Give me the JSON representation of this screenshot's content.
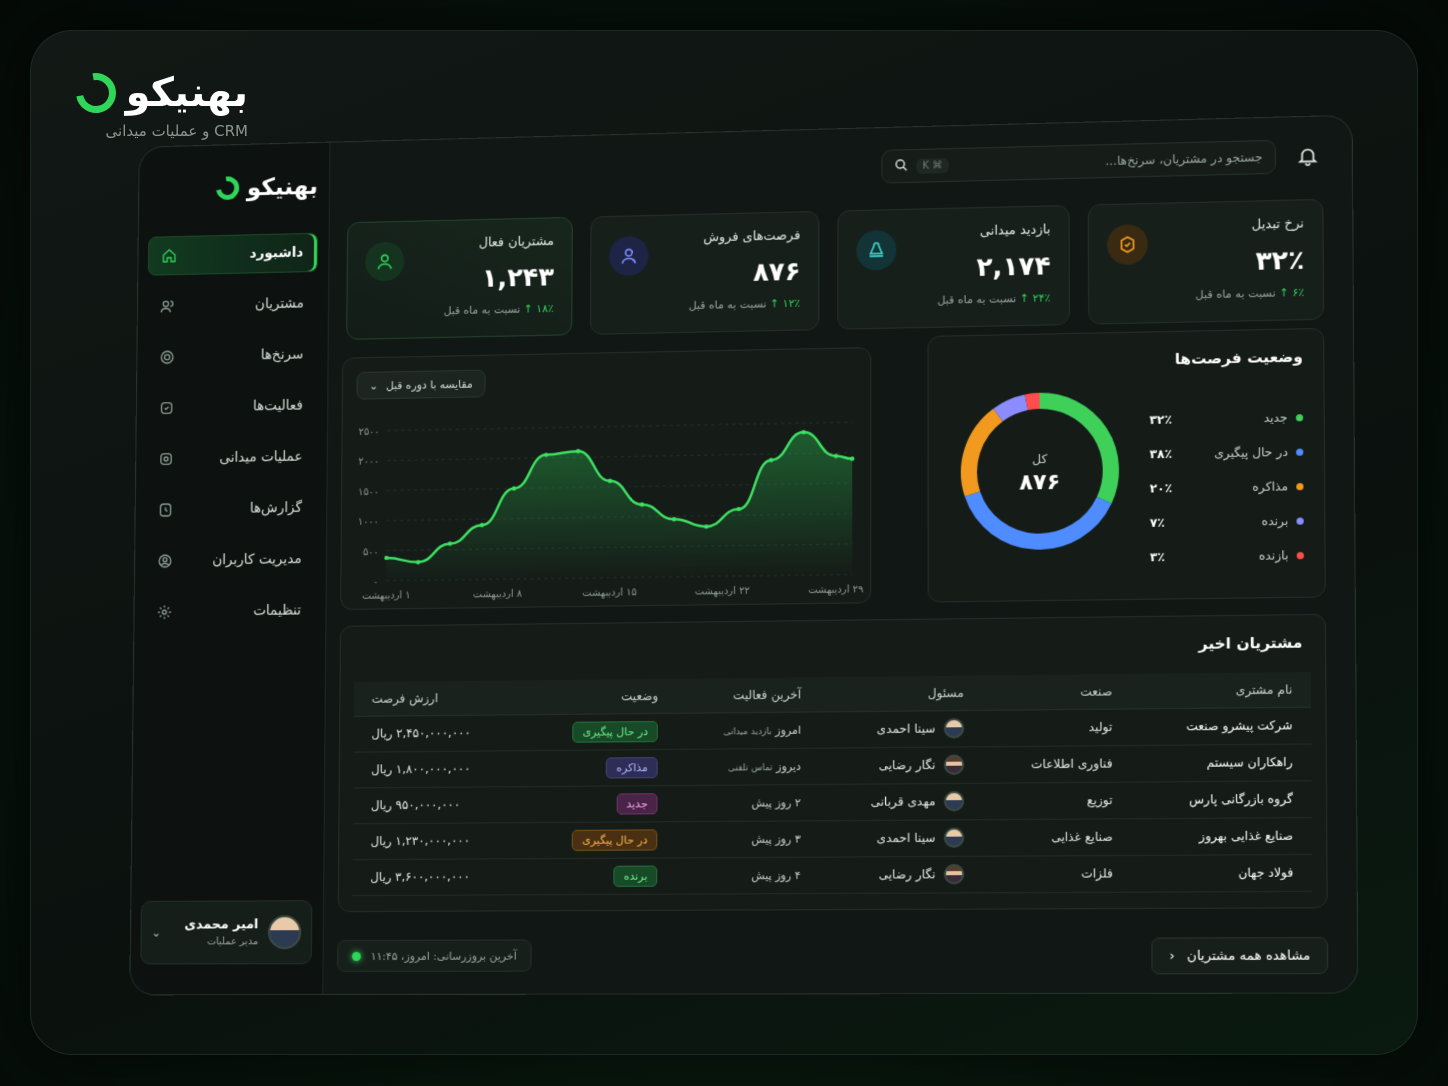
{
  "brand": {
    "name": "بهنیکو",
    "subtitle": "CRM و عملیات میدانی"
  },
  "sidebar": {
    "brand_name": "بهنیکو",
    "items": [
      {
        "label": "داشبورد",
        "icon": "home-icon"
      },
      {
        "label": "مشتریان",
        "icon": "users-icon"
      },
      {
        "label": "سرنخ‌ها",
        "icon": "target-icon"
      },
      {
        "label": "فعالیت‌ها",
        "icon": "activity-icon"
      },
      {
        "label": "عملیات میدانی",
        "icon": "field-icon"
      },
      {
        "label": "گزارش‌ها",
        "icon": "report-icon"
      },
      {
        "label": "مدیریت کاربران",
        "icon": "user-admin-icon"
      },
      {
        "label": "تنظیمات",
        "icon": "gear-icon"
      }
    ],
    "user": {
      "name": "امیر محمدی",
      "role": "مدیر عملیات"
    }
  },
  "search": {
    "placeholder": "جستجو در مشتریان، سرنخ‌ها...",
    "shortcut": "⌘ K"
  },
  "stats": [
    {
      "label": "نرخ تبدیل",
      "value": "۳۲٪",
      "change": "۶٪",
      "change_text": "نسبت به ماه قبل",
      "icon_color": "#f29a1f"
    },
    {
      "label": "بازدید میدانی",
      "value": "۲,۱۷۴",
      "change": "۲۴٪",
      "change_text": "نسبت به ماه قبل",
      "icon_color": "#3fd0c9"
    },
    {
      "label": "فرصت‌های فروش",
      "value": "۸۷۶",
      "change": "۱۲٪",
      "change_text": "نسبت به ماه قبل",
      "icon_color": "#7b8cff"
    },
    {
      "label": "مشتریان فعال",
      "value": "۱,۲۴۳",
      "change": "۱۸٪",
      "change_text": "نسبت به ماه قبل",
      "icon_color": "#2fd65a"
    }
  ],
  "chart_dropdown": "مقایسه با دوره قبل",
  "chart_data": {
    "type": "area",
    "x_labels": [
      "۱ اردیبهشت",
      "۸ اردیبهشت",
      "۱۵ اردیبهشت",
      "۲۲ اردیبهشت",
      "۲۹ اردیبهشت"
    ],
    "y_ticks": [
      "۰",
      "۵۰۰",
      "۱۰۰۰",
      "۱۵۰۰",
      "۲۰۰۰",
      "۲۵۰۰"
    ],
    "ylim": [
      0,
      2500
    ],
    "x": [
      1,
      3,
      5,
      7,
      9,
      11,
      13,
      15,
      17,
      19,
      21,
      23,
      25,
      27,
      29,
      30
    ],
    "values": [
      380,
      300,
      600,
      900,
      1500,
      2050,
      2100,
      1600,
      1200,
      950,
      820,
      1100,
      1900,
      2350,
      1950,
      1900
    ]
  },
  "donut": {
    "title": "وضعیت فرصت‌ها",
    "center_label": "کل",
    "center_value": "۸۷۶",
    "segments": [
      {
        "name": "جدید",
        "value": "۳۲٪",
        "pct": 32,
        "color": "#3fd05a"
      },
      {
        "name": "در حال پیگیری",
        "value": "۳۸٪",
        "pct": 38,
        "color": "#4e8cff"
      },
      {
        "name": "مذاکره",
        "value": "۲۰٪",
        "pct": 20,
        "color": "#f29a1f"
      },
      {
        "name": "برنده",
        "value": "۷٪",
        "pct": 7,
        "color": "#8a8cff"
      },
      {
        "name": "بازنده",
        "value": "۳٪",
        "pct": 3,
        "color": "#ff4d4d"
      }
    ]
  },
  "table": {
    "title": "مشتریان اخیر",
    "headers": [
      "نام مشتری",
      "صنعت",
      "مسئول",
      "آخرین فعالیت",
      "وضعیت",
      "ارزش فرصت"
    ],
    "rows": [
      {
        "name": "شرکت پیشرو صنعت",
        "industry": "تولید",
        "owner": "سینا احمدی",
        "activity": "امروز",
        "activity_note": "بازدید میدانی",
        "status": "در حال پیگیری",
        "status_type": "green",
        "value": "۲,۴۵۰,۰۰۰,۰۰۰ ریال"
      },
      {
        "name": "راهکاران سیستم",
        "industry": "فناوری اطلاعات",
        "owner": "نگار رضایی",
        "activity": "دیروز",
        "activity_note": "تماس تلفنی",
        "status": "مذاکره",
        "status_type": "purple",
        "value": "۱,۸۰۰,۰۰۰,۰۰۰ ریال"
      },
      {
        "name": "گروه بازرگانی پارس",
        "industry": "توزیع",
        "owner": "مهدی قربانی",
        "activity": "۲ روز پیش",
        "activity_note": "",
        "status": "جدید",
        "status_type": "pink",
        "value": "۹۵۰,۰۰۰,۰۰۰ ریال"
      },
      {
        "name": "صنایع غذایی بهروز",
        "industry": "صنایع غذایی",
        "owner": "سینا احمدی",
        "activity": "۳ روز پیش",
        "activity_note": "",
        "status": "در حال پیگیری",
        "status_type": "orange",
        "value": "۱,۲۳۰,۰۰۰,۰۰۰ ریال"
      },
      {
        "name": "فولاد جهان",
        "industry": "فلزات",
        "owner": "نگار رضایی",
        "activity": "۴ روز پیش",
        "activity_note": "",
        "status": "برنده",
        "status_type": "green",
        "value": "۳,۶۰۰,۰۰۰,۰۰۰ ریال"
      }
    ]
  },
  "footer": {
    "last_update": "آخرین بروزرسانی: امروز، ۱۱:۴۵",
    "view_all": "مشاهده همه مشتریان"
  }
}
